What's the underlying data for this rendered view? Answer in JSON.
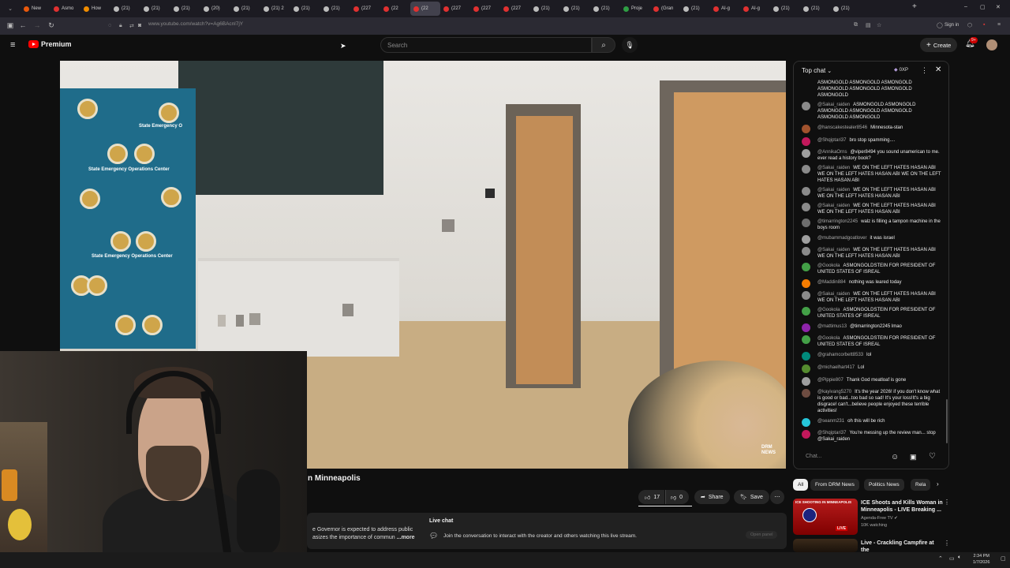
{
  "browser": {
    "tabs": [
      "New",
      "Asmo",
      "How",
      "(21)",
      "(21)",
      "(21)",
      "(20)",
      "(21)",
      "(21) 2",
      "(21)",
      "(21)",
      "(227",
      "(22",
      "(22",
      "(227",
      "(227",
      "(227",
      "(21)",
      "(21)",
      "(21)",
      "Proje",
      "(Gran",
      "(21)",
      "AI-g",
      "AI-g",
      "(21)",
      "(21)",
      "(21)"
    ],
    "url": "www.youtube.com/watch?v=Ag6BAcnl7jY",
    "sign_in_label": "Sign in"
  },
  "yt": {
    "brand": "Premium",
    "search_placeholder": "Search",
    "create_label": "Create",
    "notif_count": "9+"
  },
  "video": {
    "backdrop_label": "State Emergency Operations Center",
    "backdrop_label_short": "State Emergency O",
    "watermark": "DRM NEWS",
    "title_fragment": "n Minneapolis"
  },
  "actions": {
    "likes": "17",
    "dislikes": "0",
    "share": "Share",
    "save": "Save"
  },
  "description": {
    "line1": "e Governor is expected to address public",
    "line2": "asizes the importance of commun",
    "more": "...more",
    "live_chat_title": "Live chat",
    "live_chat_text": "Join the conversation to interact with the creator and others watching this live stream.",
    "open_panel": "Open panel"
  },
  "chat": {
    "header": "Top chat",
    "points": "0XP",
    "input_placeholder": "Chat...",
    "messages": [
      {
        "user": "",
        "text": "ASMONGOLD ASMONGOLD ASMONGOLD ASMONGOLD ASMONGOLD ASMONGOLD ASMONGOLD",
        "color": "#7a7a7a"
      },
      {
        "user": "@Sakai_raiden",
        "text": "ASMONGOLD ASMONGOLD ASMONGOLD ASMONGOLD ASMONGOLD ASMONGOLD ASMONGOLD",
        "color": "#8a8a8a"
      },
      {
        "user": "@hanscakestealer8546",
        "text": "Minnesota-stan",
        "color": "#a0522d"
      },
      {
        "user": "@Shqiptari37",
        "text": "bro stop spamming....",
        "color": "#c2185b"
      },
      {
        "user": "@AnnikaOrns",
        "text": "@viper8494 you sound unamerican to me. ever read a history book?",
        "color": "#9e9e9e"
      },
      {
        "user": "@Sakai_raiden",
        "text": "WE ON THE LEFT HATES HASAN ABI WE ON THE LEFT HATES HASAN ABI WE ON THE LEFT HATES HASAN ABI",
        "color": "#8a8a8a"
      },
      {
        "user": "@Sakai_raiden",
        "text": "WE ON THE LEFT HATES HASAN ABI WE ON THE LEFT HATES HASAN ABI",
        "color": "#8a8a8a"
      },
      {
        "user": "@Sakai_raiden",
        "text": "WE ON THE LEFT HATES HASAN ABI WE ON THE LEFT HATES HASAN ABI",
        "color": "#8a8a8a"
      },
      {
        "user": "@timarrington2245",
        "text": "walz is filling a tampon machine in the boys room",
        "color": "#6d6d6d"
      },
      {
        "user": "@mubammadgoatlover",
        "text": "it was israel",
        "color": "#9e9e9e"
      },
      {
        "user": "@Sakai_raiden",
        "text": "WE ON THE LEFT HATES HASAN ABI WE ON THE LEFT HATES HASAN ABI",
        "color": "#8a8a8a"
      },
      {
        "user": "@Gookola",
        "text": "ASMONGOLDSTEIN FOR PRESIDENT OF UNITED STATES OF ISREAL",
        "color": "#43a047"
      },
      {
        "user": "@Maddin884",
        "text": "nothing was leared today",
        "color": "#f57c00"
      },
      {
        "user": "@Sakai_raiden",
        "text": "WE ON THE LEFT HATES HASAN ABI WE ON THE LEFT HATES HASAN ABI",
        "color": "#8a8a8a"
      },
      {
        "user": "@Gookola",
        "text": "ASMONGOLDSTEIN FOR PRESIDENT OF UNITED STATES OF ISREAL",
        "color": "#43a047"
      },
      {
        "user": "@mattimus13",
        "text": "@timarrington2245 lmao",
        "color": "#8e24aa"
      },
      {
        "user": "@Gookola",
        "text": "ASMONGOLDSTEIN FOR PRESIDENT OF UNITED STATES OF ISREAL",
        "color": "#43a047"
      },
      {
        "user": "@grahamcorbett8533",
        "text": "lol",
        "color": "#00897b"
      },
      {
        "user": "@michaelhart417",
        "text": "Lol",
        "color": "#558b2f"
      },
      {
        "user": "@Pippie807",
        "text": "Thank God meatloaf is gone",
        "color": "#9e9e9e"
      },
      {
        "user": "@kayivang5270",
        "text": "It's the year 2026! if you don't know what is good or bad...too bad so sad! It's your loss!It's a big disgrace! can't...believe people enjoyed these terrible activities!",
        "color": "#6d4c41"
      },
      {
        "user": "@seanm231",
        "text": "oh this will be rich",
        "color": "#26c6da"
      },
      {
        "user": "@Shqiptari37",
        "text": "You're messing up the review man... stop @Sakai_raiden",
        "color": "#c2185b"
      }
    ]
  },
  "chips": [
    "All",
    "From DRM News",
    "Politics News",
    "Rela"
  ],
  "recommendations": [
    {
      "title": "ICE Shoots and Kills Woman in Minneapolis - LIVE Breaking ...",
      "channel": "Agenda-Free TV",
      "meta": "10K watching",
      "thumb_text": "ICE SHOOTING IN MINNEAPOLIS",
      "badge": "LIVE"
    },
    {
      "title": "Live - Crackling Campfire at the",
      "channel": "",
      "meta": "",
      "thumb_text": "",
      "badge": ""
    }
  ],
  "taskbar": {
    "time": "2:34 PM",
    "date": "1/7/2026"
  }
}
